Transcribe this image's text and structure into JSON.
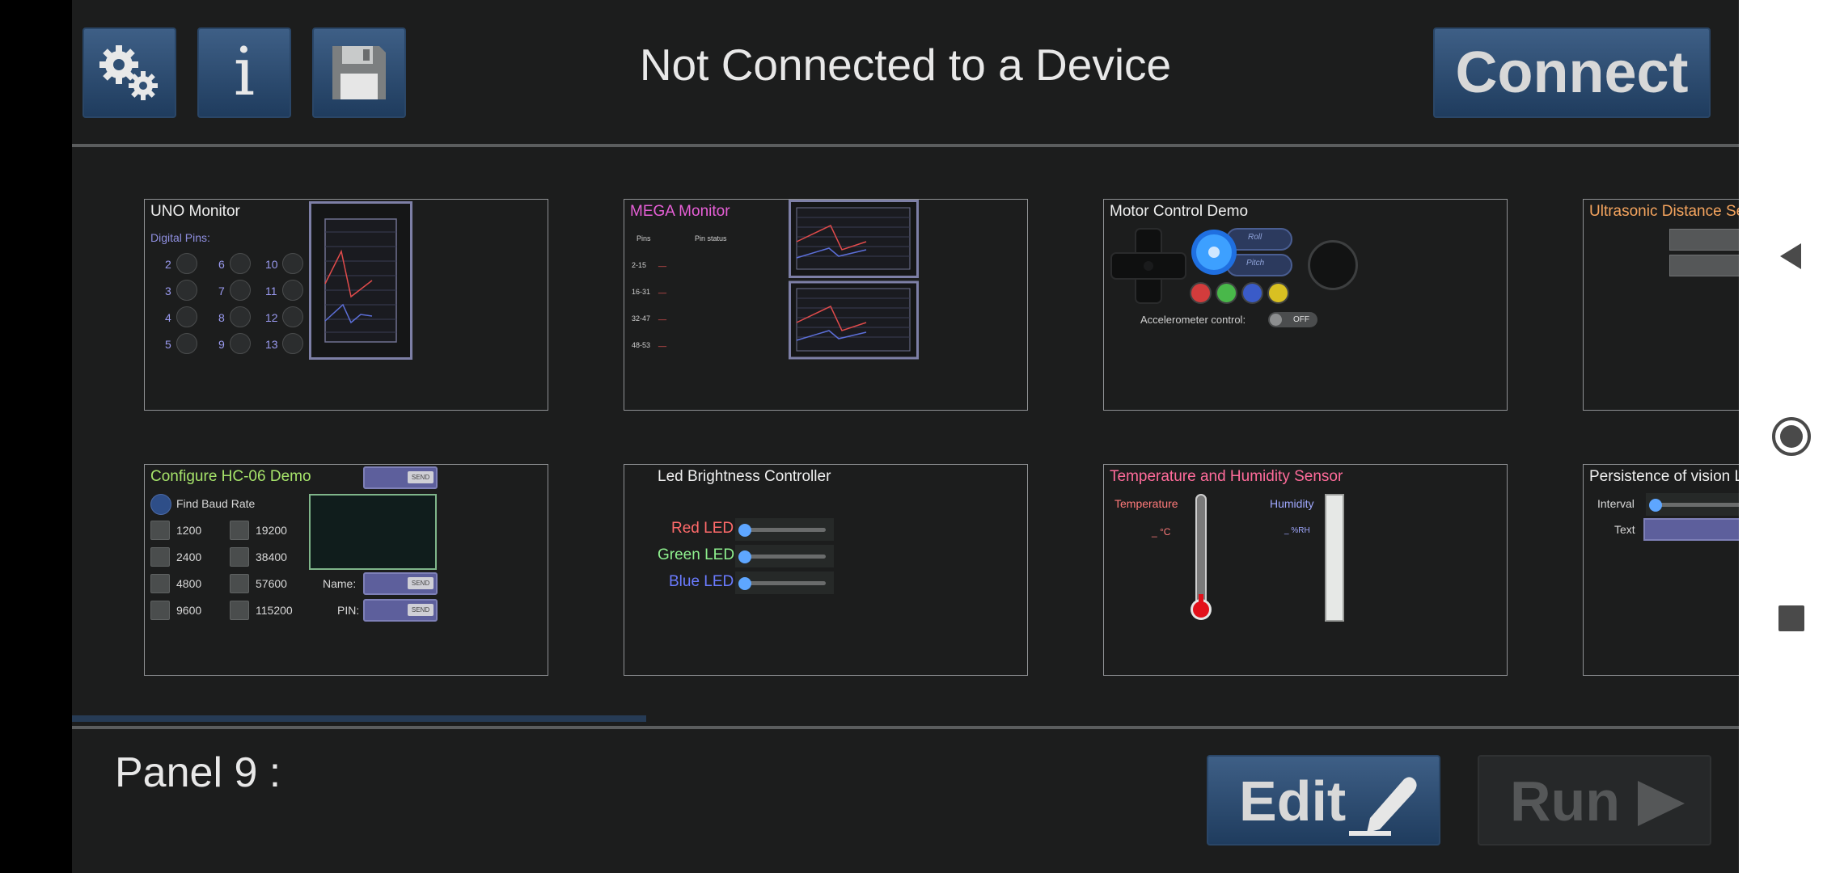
{
  "header": {
    "title": "Not Connected to a Device",
    "connect_label": "Connect",
    "icons": [
      "gears-icon",
      "info-icon",
      "save-icon"
    ],
    "info_glyph": "i"
  },
  "panels": {
    "uno": {
      "title": "UNO Monitor",
      "digital_label": "Digital Pins:",
      "pins": [
        "2",
        "3",
        "4",
        "5",
        "6",
        "7",
        "8",
        "9",
        "10",
        "11",
        "12",
        "13"
      ]
    },
    "mega": {
      "title": "MEGA Monitor",
      "col_pins": "Pins",
      "col_status": "Pin status",
      "rows": [
        {
          "range": "2-15",
          "status": "__"
        },
        {
          "range": "16-31",
          "status": "__"
        },
        {
          "range": "32-47",
          "status": "__"
        },
        {
          "range": "48-53",
          "status": "__"
        }
      ]
    },
    "motor": {
      "title": "Motor Control Demo",
      "roll": "Roll",
      "pitch": "Pitch",
      "accel_label": "Accelerometer control:",
      "toggle": "OFF"
    },
    "ultrasonic": {
      "title": "Ultrasonic Distance Se"
    },
    "hc06": {
      "title": "Configure HC-06 Demo",
      "find_baud": "Find Baud Rate",
      "rates": [
        "1200",
        "19200",
        "2400",
        "38400",
        "4800",
        "57600",
        "9600",
        "115200"
      ],
      "name_label": "Name:",
      "pin_label": "PIN:",
      "send": "SEND"
    },
    "led": {
      "title": "Led Brightness Controller",
      "red": "Red LED",
      "green": "Green LED",
      "blue": "Blue LED"
    },
    "temp": {
      "title": "Temperature and Humidity Sensor",
      "temp_label": "Temperature",
      "temp_value": "_ °C",
      "hum_label": "Humidity",
      "hum_value": "_ %RH"
    },
    "pov": {
      "title": "Persistence of vision L",
      "interval": "Interval",
      "text": "Text"
    }
  },
  "footer": {
    "panel_label": "Panel 9 :",
    "edit_label": "Edit",
    "run_label": "Run"
  },
  "colors": {
    "button": "#2f4f74",
    "mega_title": "#e65fd6",
    "hc06_title": "#a6e36a",
    "temp_title": "#ff6b9a",
    "ultra_title": "#f4a45e",
    "red_led": "#ff6a6a",
    "green_led": "#8ef08e",
    "blue_led": "#6a7bff"
  }
}
